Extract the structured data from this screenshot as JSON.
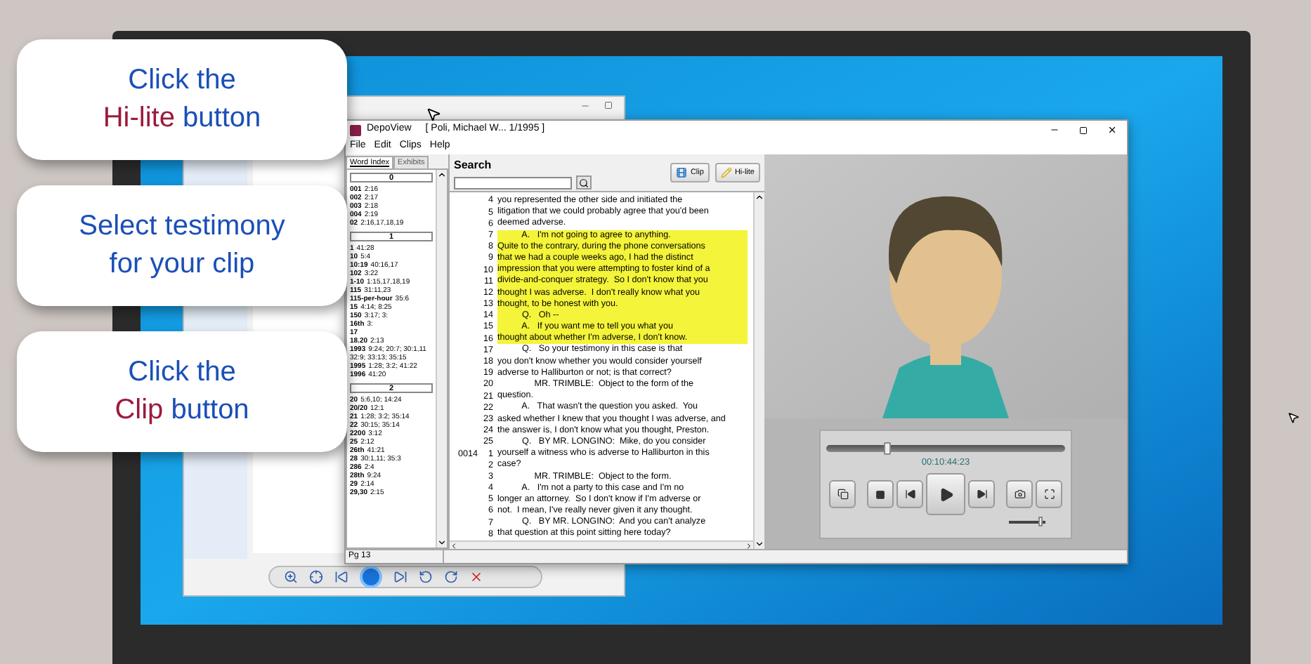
{
  "callouts": [
    {
      "lines": [
        [
          {
            "text": "Click the",
            "accent": false
          }
        ],
        [
          {
            "text": "Hi-lite",
            "accent": true
          },
          {
            "text": "button",
            "accent": false
          }
        ]
      ]
    },
    {
      "lines": [
        [
          {
            "text": "Select testimony",
            "accent": false
          }
        ],
        [
          {
            "text": "for your clip",
            "accent": false
          }
        ]
      ]
    },
    {
      "lines": [
        [
          {
            "text": "Click the",
            "accent": false
          }
        ],
        [
          {
            "text": "Clip",
            "accent": true
          },
          {
            "text": "button",
            "accent": false
          }
        ]
      ]
    }
  ],
  "window": {
    "app_name": "DepoView",
    "document": "[ Poli, Michael W... 1/1995 ]"
  },
  "menu": [
    "File",
    "Edit",
    "Clips",
    "Help"
  ],
  "tabs": [
    {
      "label": "Word Index",
      "selected": true
    },
    {
      "label": "Exhibits",
      "selected": false
    }
  ],
  "word_index": [
    {
      "heading": "0",
      "entries": [
        {
          "term": "001",
          "refs": "2:16"
        },
        {
          "term": "002",
          "refs": "2:17"
        },
        {
          "term": "003",
          "refs": "2:18"
        },
        {
          "term": "004",
          "refs": "2:19"
        },
        {
          "term": "02",
          "refs": "2:16,17,18,19"
        }
      ]
    },
    {
      "heading": "1",
      "entries": [
        {
          "term": "1",
          "refs": "41:28"
        },
        {
          "term": "10",
          "refs": "5:4"
        },
        {
          "term": "10:19",
          "refs": "40:16,17"
        },
        {
          "term": "102",
          "refs": "3:22"
        },
        {
          "term": "1-10",
          "refs": "1:15,17,18,19"
        },
        {
          "term": "115",
          "refs": "31:11,23"
        },
        {
          "term": "115-per-hour",
          "refs": "35:6"
        },
        {
          "term": "15",
          "refs": "4:14; 8:25"
        },
        {
          "term": "150",
          "refs": "3:17; 3:"
        },
        {
          "term": "16th",
          "refs": "3:"
        },
        {
          "term": "17"
        },
        {
          "term": "18.20",
          "refs": "2:13"
        },
        {
          "term": "1993",
          "refs": "9:24; 20:7; 30:1,11"
        },
        {
          "refs": "32:9; 33:13; 35:15"
        },
        {
          "term": "1995",
          "refs": "1:28; 3:2; 41:22"
        },
        {
          "term": "1996",
          "refs": "41:20"
        }
      ]
    },
    {
      "heading": "2",
      "entries": [
        {
          "term": "20",
          "refs": "5:6,10; 14:24"
        },
        {
          "term": "20/20",
          "refs": "12:1"
        },
        {
          "term": "21",
          "refs": "1:28; 3:2; 35:14"
        },
        {
          "term": "22",
          "refs": "30:15; 35:14"
        },
        {
          "term": "2200",
          "refs": "3:12"
        },
        {
          "term": "25",
          "refs": "2:12"
        },
        {
          "term": "26th",
          "refs": "41:21"
        },
        {
          "term": "28",
          "refs": "30:1,11; 35:3"
        },
        {
          "term": "286",
          "refs": "2:4"
        },
        {
          "term": "28th",
          "refs": "9:24"
        },
        {
          "term": "29",
          "refs": "2:14"
        },
        {
          "term": "29,30",
          "refs": "2:15"
        }
      ]
    }
  ],
  "search": {
    "label": "Search"
  },
  "toolbar_buttons": [
    {
      "kind": "clip",
      "label": "Clip"
    },
    {
      "kind": "hilite",
      "label": "Hi-lite"
    }
  ],
  "transcript": [
    {
      "line": "4",
      "text": "you represented the other side and initiated the",
      "highlighted": false
    },
    {
      "line": "5",
      "text": "litigation that we could probably agree that you'd been",
      "highlighted": false
    },
    {
      "line": "6",
      "text": "deemed adverse.",
      "highlighted": false
    },
    {
      "line": "7",
      "text": "          A.   I'm not going to agree to anything.",
      "highlighted": true
    },
    {
      "line": "8",
      "text": "Quite to the contrary, during the phone conversations",
      "highlighted": true
    },
    {
      "line": "9",
      "text": "that we had a couple weeks ago, I had the distinct",
      "highlighted": true
    },
    {
      "line": "10",
      "text": "impression that you were attempting to foster kind of a",
      "highlighted": true
    },
    {
      "line": "11",
      "text": "divide-and-conquer strategy.  So I don't know that you",
      "highlighted": true
    },
    {
      "line": "12",
      "text": "thought I was adverse.  I don't really know what you",
      "highlighted": true
    },
    {
      "line": "13",
      "text": "thought, to be honest with you.",
      "highlighted": true
    },
    {
      "line": "14",
      "text": "          Q.   Oh --",
      "highlighted": true
    },
    {
      "line": "15",
      "text": "          A.   If you want me to tell you what you",
      "highlighted": true
    },
    {
      "line": "16",
      "text": "thought about whether I'm adverse, I don't know.",
      "highlighted": true
    },
    {
      "line": "17",
      "text": "          Q.   So your testimony in this case is that",
      "highlighted": false
    },
    {
      "line": "18",
      "text": "you don't know whether you would consider yourself",
      "highlighted": false
    },
    {
      "line": "19",
      "text": "adverse to Halliburton or not; is that correct?",
      "highlighted": false
    },
    {
      "line": "20",
      "text": "               MR. TRIMBLE:  Object to the form of the",
      "highlighted": false
    },
    {
      "line": "21",
      "text": "question.",
      "highlighted": false
    },
    {
      "line": "22",
      "text": "          A.   That wasn't the question you asked.  You",
      "highlighted": false
    },
    {
      "line": "23",
      "text": "asked whether I knew that you thought I was adverse, and",
      "highlighted": false
    },
    {
      "line": "24",
      "text": "the answer is, I don't know what you thought, Preston.",
      "highlighted": false
    },
    {
      "line": "25",
      "text": "          Q.   BY MR. LONGINO:  Mike, do you consider",
      "highlighted": false
    },
    {
      "page": "0014",
      "line": "1",
      "text": "yourself a witness who is adverse to Halliburton in this",
      "highlighted": false
    },
    {
      "line": "2",
      "text": "case?",
      "highlighted": false
    },
    {
      "line": "3",
      "text": "               MR. TRIMBLE:  Object to the form.",
      "highlighted": false
    },
    {
      "line": "4",
      "text": "          A.   I'm not a party to this case and I'm no",
      "highlighted": false
    },
    {
      "line": "5",
      "text": "longer an attorney.  So I don't know if I'm adverse or",
      "highlighted": false
    },
    {
      "line": "6",
      "text": "not.  I mean, I've really never given it any thought.",
      "highlighted": false
    },
    {
      "line": "7",
      "text": "          Q.   BY MR. LONGINO:  And you can't analyze",
      "highlighted": false
    },
    {
      "line": "8",
      "text": "that question at this point sitting here today?",
      "highlighted": false
    }
  ],
  "status_bar": "Pg 13",
  "player": {
    "progress": {
      "level": 0.25
    },
    "timecode": "00:10:44:23",
    "volume": {
      "level": 0.85
    }
  }
}
